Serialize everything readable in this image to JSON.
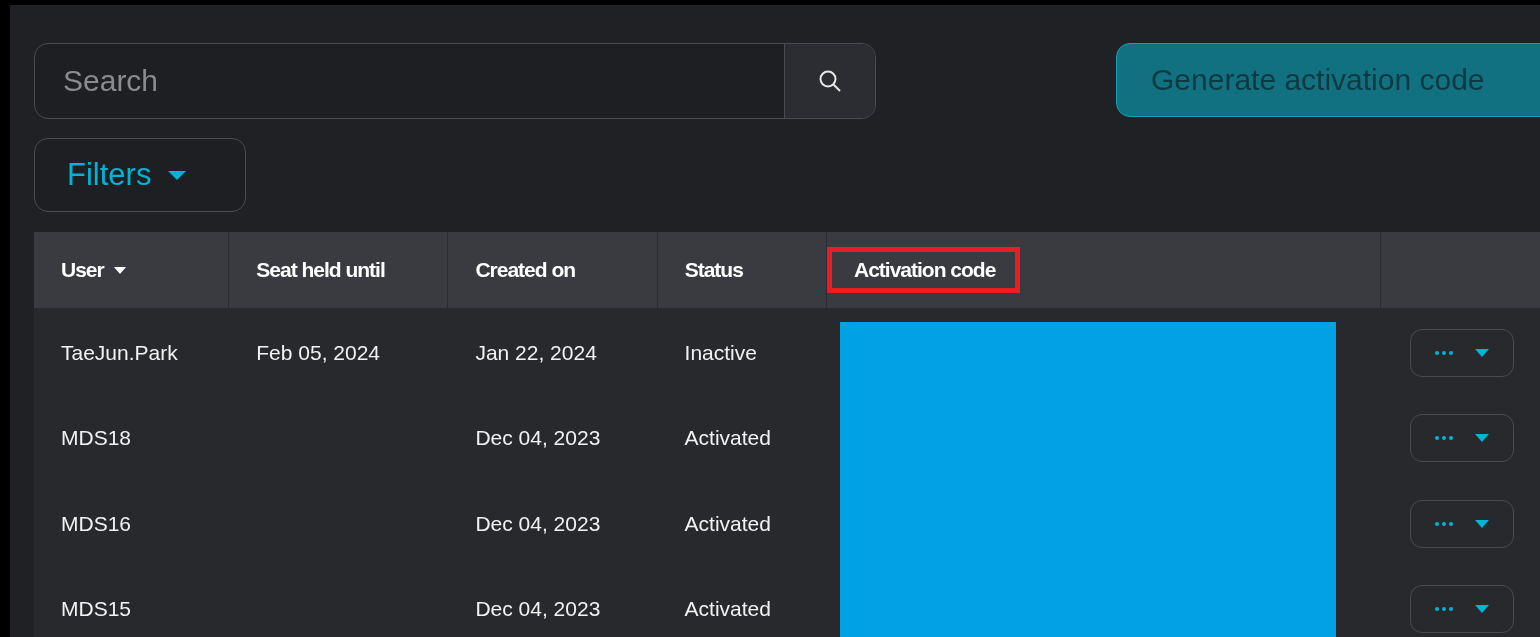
{
  "search": {
    "placeholder": "Search"
  },
  "generate_button": {
    "label": "Generate activation code",
    "disabled": true
  },
  "filters_button": {
    "label": "Filters"
  },
  "table": {
    "columns": [
      {
        "label": "User",
        "sorted": true
      },
      {
        "label": "Seat held until",
        "sorted": false
      },
      {
        "label": "Created on",
        "sorted": false
      },
      {
        "label": "Status",
        "sorted": false
      },
      {
        "label": "Activation code",
        "sorted": false,
        "highlighted": true
      }
    ],
    "rows": [
      {
        "user": "TaeJun.Park",
        "seat_held_until": "Feb 05, 2024",
        "created_on": "Jan 22, 2024",
        "status": "Inactive"
      },
      {
        "user": "MDS18",
        "seat_held_until": "",
        "created_on": "Dec 04, 2023",
        "status": "Activated"
      },
      {
        "user": "MDS16",
        "seat_held_until": "",
        "created_on": "Dec 04, 2023",
        "status": "Activated"
      },
      {
        "user": "MDS15",
        "seat_held_until": "",
        "created_on": "Dec 04, 2023",
        "status": "Activated"
      }
    ]
  }
}
